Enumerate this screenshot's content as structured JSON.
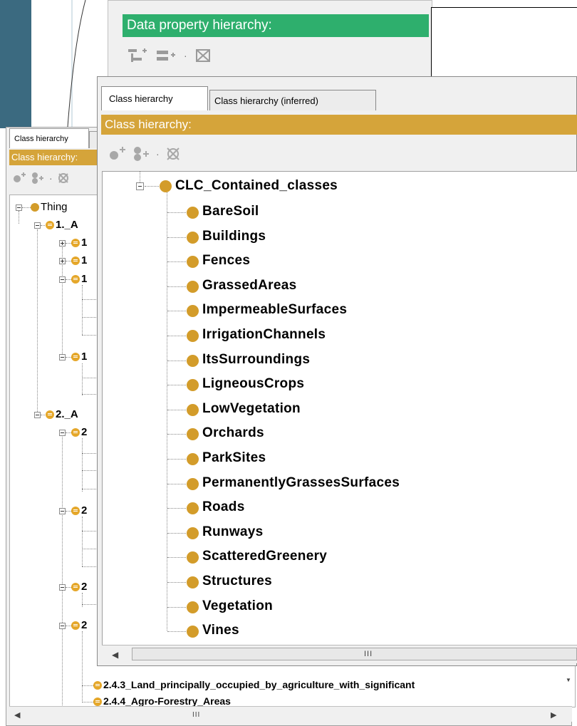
{
  "data_property_panel": {
    "header": "Data property hierarchy:"
  },
  "back_window": {
    "tab": "Class hierarchy",
    "header": "Class hierarchy:",
    "root": "Thing",
    "rows": [
      "1._A",
      "1",
      "1",
      "1",
      "1",
      "2._A",
      "2",
      "2",
      "2",
      "2"
    ],
    "bottom_rows": [
      "2.4.3_Land_principally_occupied_by_agriculture_with_significant",
      "2.4.4_Agro-Forestry_Areas"
    ]
  },
  "front_window": {
    "tabs": [
      "Class hierarchy",
      "Class hierarchy (inferred)"
    ],
    "header": "Class hierarchy:",
    "parent": "CLC_Contained_classes",
    "children": [
      "BareSoil",
      "Buildings",
      "Fences",
      "GrassedAreas",
      "ImpermeableSurfaces",
      "IrrigationChannels",
      "ItsSurroundings",
      "LigneousCrops",
      "LowVegetation",
      "Orchards",
      "ParkSites",
      "PermanentlyGrassesSurfaces",
      "Roads",
      "Runways",
      "ScatteredGreenery",
      "Structures",
      "Vegetation",
      "Vines"
    ]
  },
  "scrollbar": {
    "grip": "III",
    "left_arrow": "◀",
    "right_arrow": "▶",
    "down_arrow": "▼"
  },
  "colors": {
    "class_header": "#d5a43a",
    "data_header": "#2eaf6d",
    "class_node": "#d39c2a",
    "slide_dark": "#3b6a80"
  }
}
